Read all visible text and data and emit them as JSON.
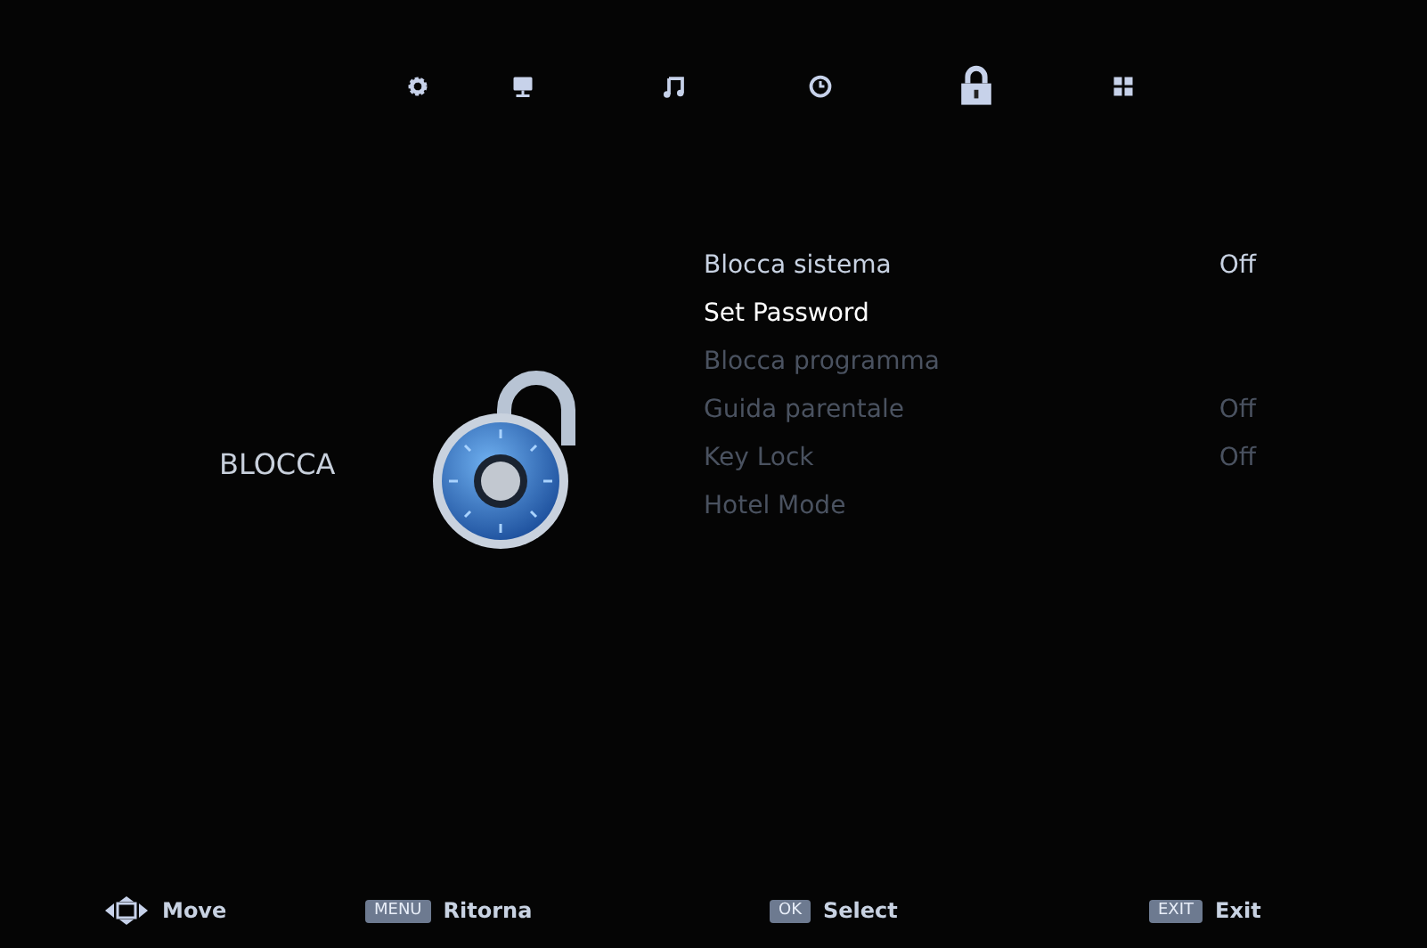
{
  "tabs": [
    {
      "kind": "gear",
      "selected": false
    },
    {
      "kind": "monitor",
      "selected": false
    },
    {
      "kind": "music",
      "selected": false
    },
    {
      "kind": "clock",
      "selected": false
    },
    {
      "kind": "lock",
      "selected": true
    },
    {
      "kind": "grid",
      "selected": false
    }
  ],
  "section": {
    "title": "BLOCCA"
  },
  "items": [
    {
      "label": "Blocca sistema",
      "value": "Off",
      "selected": false,
      "disabled": false
    },
    {
      "label": "Set Password",
      "selected": true,
      "disabled": false
    },
    {
      "label": "Blocca programma",
      "selected": false,
      "disabled": true
    },
    {
      "label": "Guida parentale",
      "value": "Off",
      "selected": false,
      "disabled": true
    },
    {
      "label": "Key Lock",
      "value": "Off",
      "selected": false,
      "disabled": true
    },
    {
      "label": "Hotel Mode",
      "selected": false,
      "disabled": true
    }
  ],
  "footer": [
    {
      "kind": "arrows",
      "label": "Move"
    },
    {
      "kind": "key",
      "key": "MENU",
      "label": "Ritorna"
    },
    {
      "kind": "key",
      "key": "OK",
      "label": "Select"
    },
    {
      "kind": "key",
      "key": "EXIT",
      "label": "Exit"
    }
  ]
}
